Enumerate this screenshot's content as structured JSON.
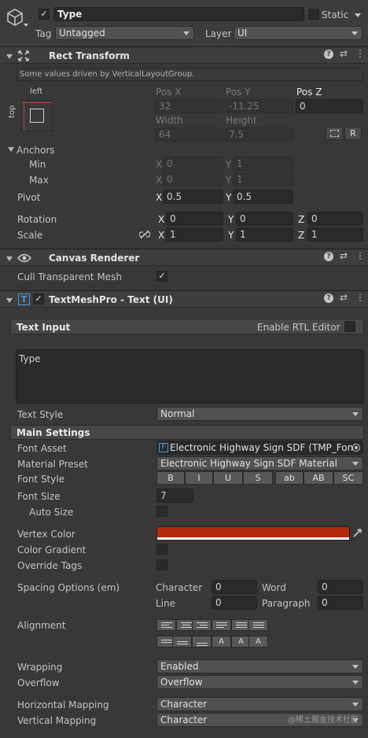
{
  "header": {
    "object_name": "Type",
    "active_checked": true,
    "static_label": "Static",
    "tag_label": "Tag",
    "tag_value": "Untagged",
    "layer_label": "Layer",
    "layer_value": "UI"
  },
  "rect_transform": {
    "title": "Rect Transform",
    "driven_note": "Some values driven by VerticalLayoutGroup.",
    "anchor_h": "left",
    "anchor_v": "top",
    "pos_x_label": "Pos X",
    "pos_y_label": "Pos Y",
    "pos_z_label": "Pos Z",
    "pos_x": "32",
    "pos_y": "-11.25",
    "pos_z": "0",
    "width_label": "Width",
    "height_label": "Height",
    "width": "64",
    "height": "7.5",
    "r_button": "R",
    "anchors_label": "Anchors",
    "min_label": "Min",
    "max_label": "Max",
    "min_x": "0",
    "min_y": "1",
    "max_x": "0",
    "max_y": "1",
    "pivot_label": "Pivot",
    "pivot_x": "0.5",
    "pivot_y": "0.5",
    "rotation_label": "Rotation",
    "rot_x": "0",
    "rot_y": "0",
    "rot_z": "0",
    "scale_label": "Scale",
    "scale_x": "1",
    "scale_y": "1",
    "scale_z": "1",
    "x": "X",
    "y": "Y",
    "z": "Z"
  },
  "canvas_renderer": {
    "title": "Canvas Renderer",
    "cull_label": "Cull Transparent Mesh",
    "cull_checked": true
  },
  "tmp": {
    "title": "TextMeshPro - Text (UI)",
    "text_input_label": "Text Input",
    "rtl_label": "Enable RTL Editor",
    "text_value": "Type",
    "text_style_label": "Text Style",
    "text_style_value": "Normal",
    "main_settings_label": "Main Settings",
    "font_asset_label": "Font Asset",
    "font_asset_value": "Electronic Highway Sign SDF (TMP_Font",
    "material_preset_label": "Material Preset",
    "material_preset_value": "Electronic Highway Sign SDF Material",
    "font_style_label": "Font Style",
    "font_style_buttons": [
      "B",
      "I",
      "U",
      "S",
      "ab",
      "AB",
      "SC"
    ],
    "font_size_label": "Font Size",
    "font_size_value": "7",
    "auto_size_label": "Auto Size",
    "vertex_color_label": "Vertex Color",
    "vertex_color": "#b52a0a",
    "color_gradient_label": "Color Gradient",
    "override_tags_label": "Override Tags",
    "spacing_label": "Spacing Options (em)",
    "character_label": "Character",
    "character_value": "0",
    "word_label": "Word",
    "word_value": "0",
    "line_label": "Line",
    "line_value": "0",
    "paragraph_label": "Paragraph",
    "paragraph_value": "0",
    "alignment_label": "Alignment",
    "wrapping_label": "Wrapping",
    "wrapping_value": "Enabled",
    "overflow_label": "Overflow",
    "overflow_value": "Overflow",
    "hmap_label": "Horizontal Mapping",
    "hmap_value": "Character",
    "vmap_label": "Vertical Mapping",
    "vmap_value": "Character"
  },
  "watermark": "@稀土掘金技术社区"
}
